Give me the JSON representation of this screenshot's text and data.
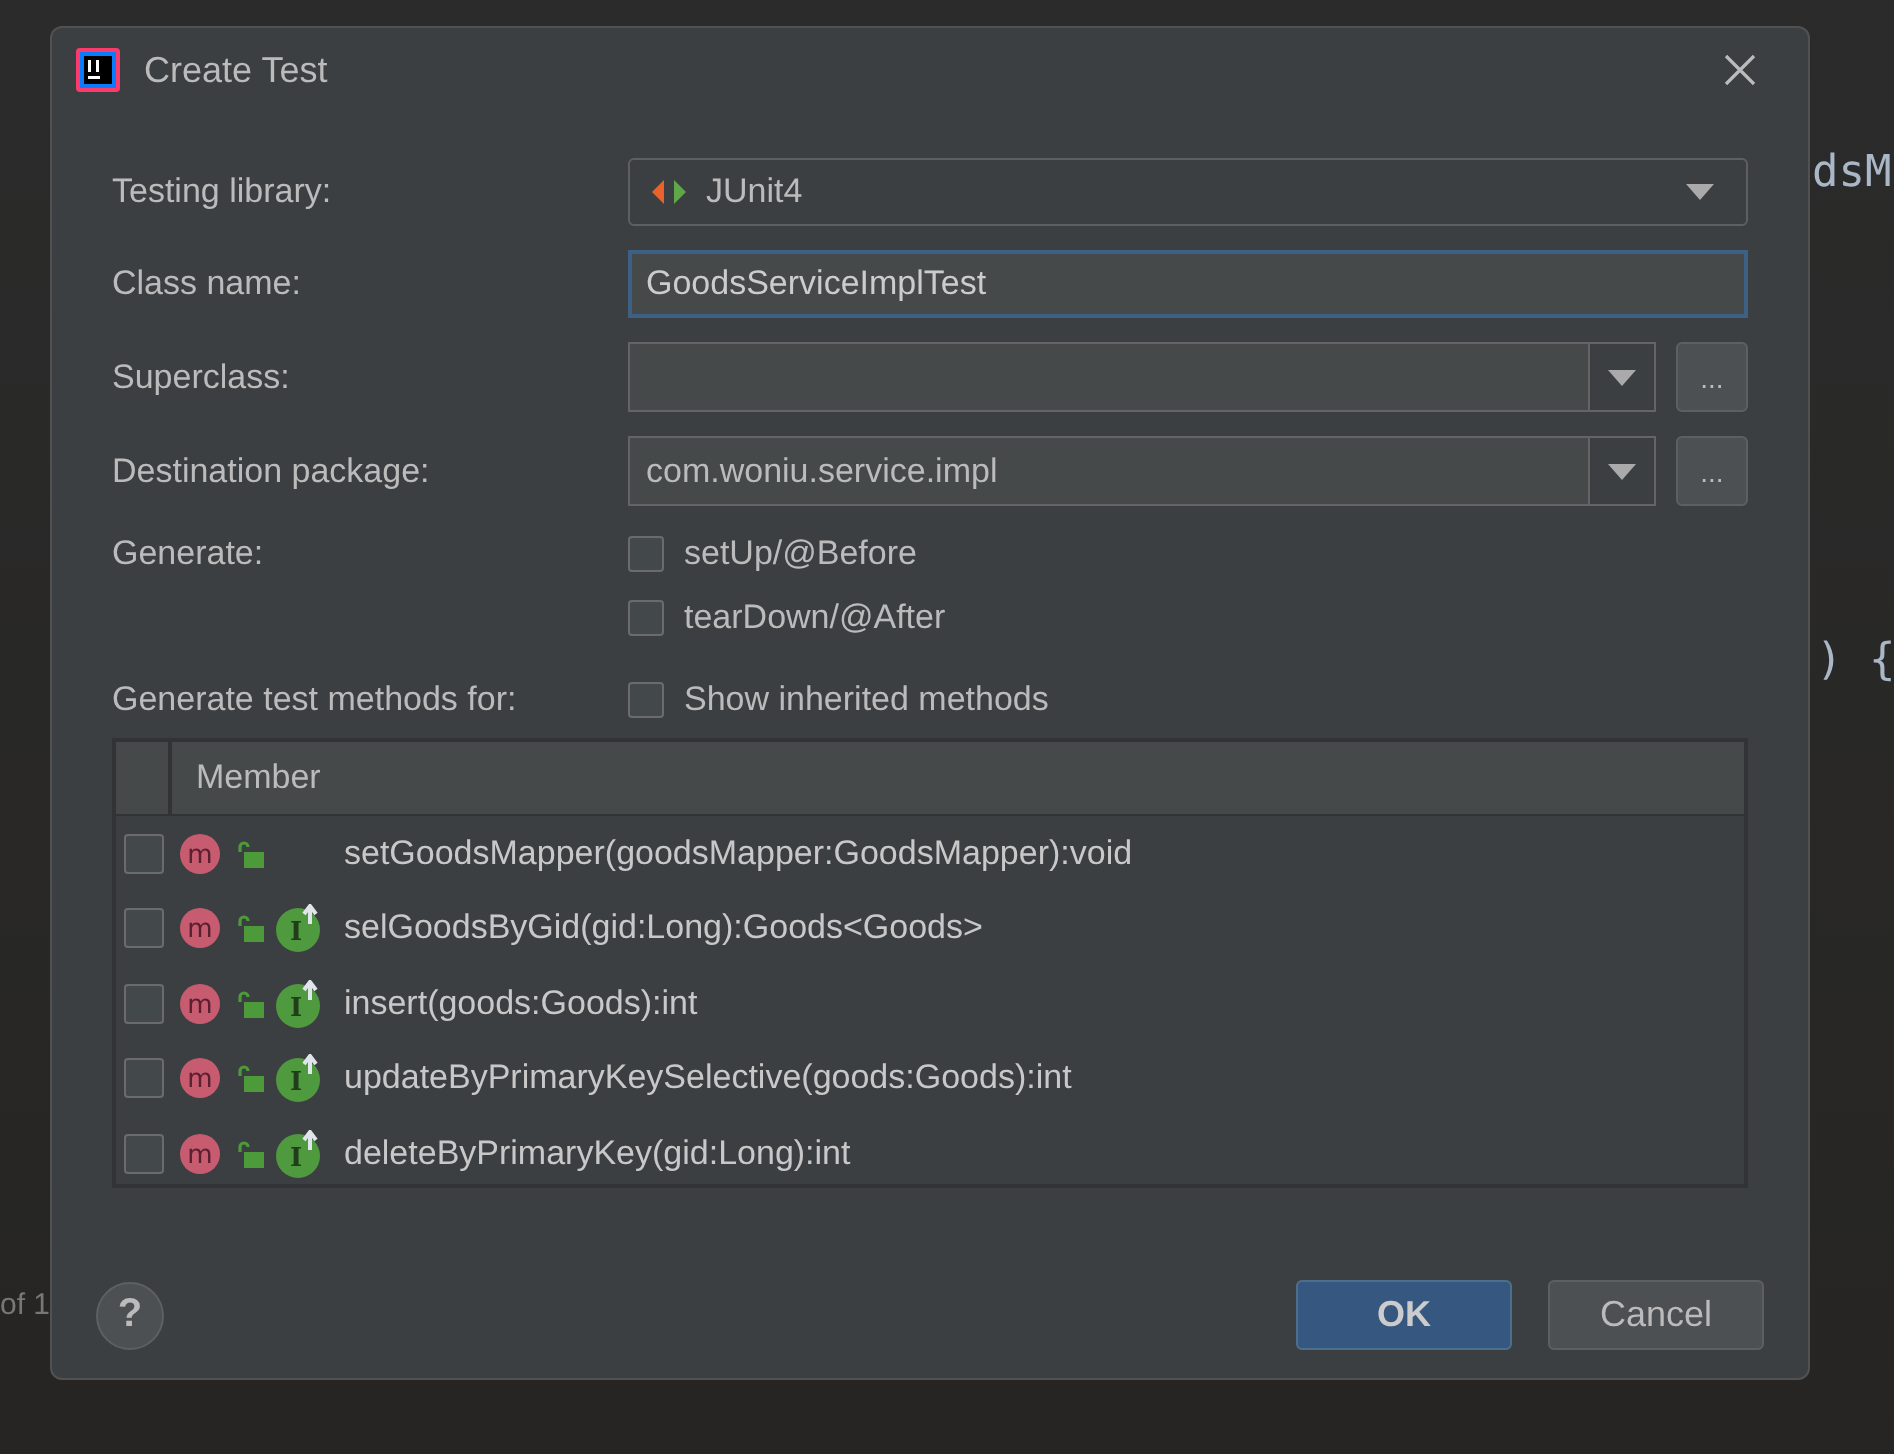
{
  "window": {
    "title": "Create Test"
  },
  "background_code": [
    {
      "text": "dsM"
    },
    {
      "text": ") {"
    },
    {
      "text": "of 1"
    }
  ],
  "fields": [
    {
      "kind": "dropdown",
      "label": "Testing library:",
      "value": "JUnit4"
    },
    {
      "kind": "text",
      "label": "Class name:",
      "value": "GoodsServiceImplTest",
      "focused": true
    },
    {
      "kind": "combo",
      "label": "Superclass:",
      "browse": "..."
    },
    {
      "kind": "combo",
      "label": "Destination package:",
      "value": "com.woniu.service.impl",
      "browse": "..."
    }
  ],
  "generate": {
    "label": "Generate:",
    "options": [
      {
        "label": "setUp/@Before",
        "checked": false
      },
      {
        "label": "tearDown/@After",
        "checked": false
      }
    ]
  },
  "methods": {
    "label": "Generate test methods for:",
    "show_inherited": {
      "label": "Show inherited methods",
      "checked": false
    },
    "columns": [
      "Member"
    ],
    "rows": [
      {
        "method_icon": "m",
        "signature": "setGoodsMapper(goodsMapper:GoodsMapper):void",
        "checked": false
      },
      {
        "method_icon": "m",
        "interface_icon": "I",
        "signature": "selGoodsByGid(gid:Long):Goods<Goods>",
        "checked": false
      },
      {
        "method_icon": "m",
        "interface_icon": "I",
        "signature": "insert(goods:Goods):int",
        "checked": false
      },
      {
        "method_icon": "m",
        "interface_icon": "I",
        "signature": "updateByPrimaryKeySelective(goods:Goods):int",
        "checked": false
      },
      {
        "method_icon": "m",
        "interface_icon": "I",
        "signature": "deleteByPrimaryKey(gid:Long):int",
        "checked": false
      }
    ]
  },
  "help": "?",
  "buttons": [
    {
      "label": "OK",
      "default": true
    },
    {
      "label": "Cancel",
      "default": false
    }
  ]
}
